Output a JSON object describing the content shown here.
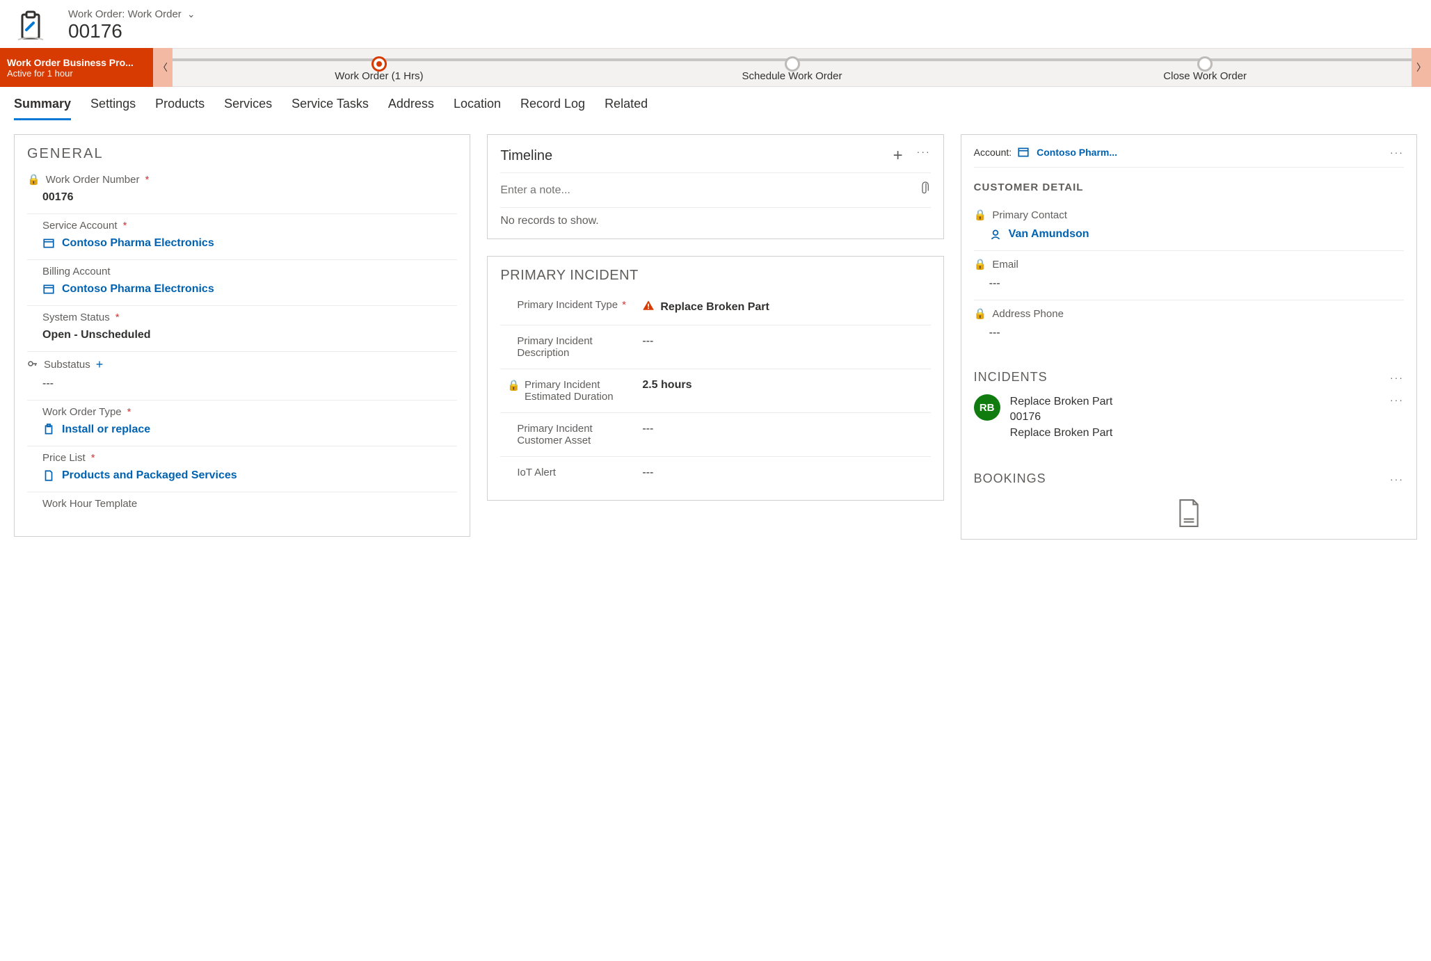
{
  "header": {
    "record_type": "Work Order: Work Order",
    "record_title": "00176"
  },
  "bpf": {
    "name": "Work Order Business Pro...",
    "duration": "Active for 1 hour",
    "stages": [
      {
        "label": "Work Order  (1 Hrs)",
        "active": true
      },
      {
        "label": "Schedule Work Order",
        "active": false
      },
      {
        "label": "Close Work Order",
        "active": false
      }
    ]
  },
  "tabs": [
    {
      "label": "Summary",
      "active": true
    },
    {
      "label": "Settings"
    },
    {
      "label": "Products"
    },
    {
      "label": "Services"
    },
    {
      "label": "Service Tasks"
    },
    {
      "label": "Address"
    },
    {
      "label": "Location"
    },
    {
      "label": "Record Log"
    },
    {
      "label": "Related"
    }
  ],
  "general": {
    "title": "GENERAL",
    "fields": {
      "work_order_number_label": "Work Order Number",
      "work_order_number_value": "00176",
      "service_account_label": "Service Account",
      "service_account_value": "Contoso Pharma Electronics",
      "billing_account_label": "Billing Account",
      "billing_account_value": "Contoso Pharma Electronics",
      "system_status_label": "System Status",
      "system_status_value": "Open - Unscheduled",
      "substatus_label": "Substatus",
      "substatus_value": "---",
      "work_order_type_label": "Work Order Type",
      "work_order_type_value": "Install or replace",
      "price_list_label": "Price List",
      "price_list_value": "Products and Packaged Services",
      "work_hour_template_label": "Work Hour Template"
    }
  },
  "timeline": {
    "title": "Timeline",
    "placeholder": "Enter a note...",
    "empty": "No records to show."
  },
  "primary_incident": {
    "title": "PRIMARY INCIDENT",
    "rows": {
      "type_label": "Primary Incident Type",
      "type_value": "Replace Broken Part",
      "desc_label": "Primary Incident Description",
      "desc_value": "---",
      "dur_label": "Primary Incident Estimated Duration",
      "dur_value": "2.5 hours",
      "asset_label": "Primary Incident Customer Asset",
      "asset_value": "---",
      "iot_label": "IoT Alert",
      "iot_value": "---"
    }
  },
  "account": {
    "label": "Account:",
    "value": "Contoso Pharm..."
  },
  "customer_detail": {
    "title": "CUSTOMER DETAIL",
    "primary_contact_label": "Primary Contact",
    "primary_contact_value": "Van Amundson",
    "email_label": "Email",
    "email_value": "---",
    "address_phone_label": "Address Phone",
    "address_phone_value": "---"
  },
  "incidents": {
    "title": "INCIDENTS",
    "item": {
      "avatar": "RB",
      "line1": "Replace Broken Part",
      "line2": "00176",
      "line3": "Replace Broken Part"
    }
  },
  "bookings": {
    "title": "BOOKINGS"
  }
}
